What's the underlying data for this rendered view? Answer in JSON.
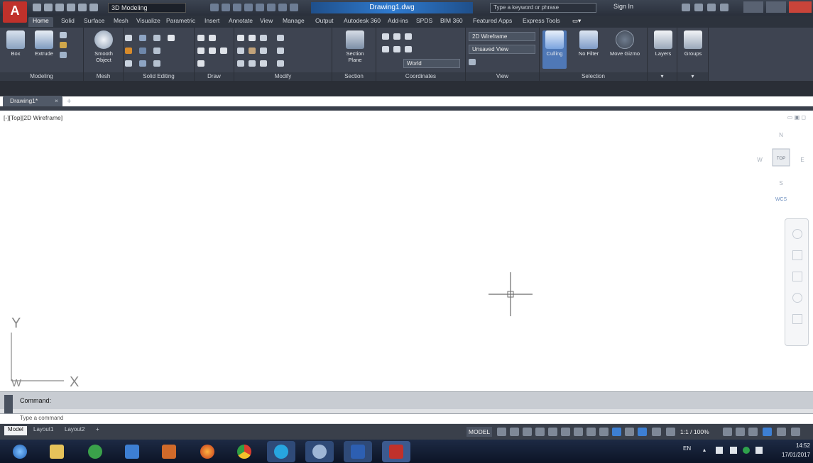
{
  "title_bar": {
    "logo": "A",
    "workspace": "3D Modeling",
    "file_title": "Drawing1.dwg",
    "search_placeholder": "Type a keyword or phrase",
    "sign_in": "Sign In"
  },
  "ribbon": {
    "tabs": [
      "Home",
      "Solid",
      "Surface",
      "Mesh",
      "Visualize",
      "Parametric",
      "Insert",
      "Annotate",
      "View",
      "Manage",
      "Output",
      "Autodesk 360",
      "Add-ins",
      "SPDS",
      "BIM 360",
      "Featured Apps",
      "Express Tools"
    ],
    "active_tab": "Home",
    "panels": {
      "modeling": "Modeling",
      "mesh": "Mesh",
      "solid_editing": "Solid Editing",
      "draw": "Draw",
      "modify": "Modify",
      "section": "Section",
      "coordinates": "Coordinates",
      "view": "View",
      "selection": "Selection"
    },
    "buttons": {
      "box": "Box",
      "extrude": "Extrude",
      "smooth_object": "Smooth Object",
      "section_plane": "Section Plane",
      "culling": "Culling",
      "no_filter": "No Filter",
      "move_gizmo": "Move Gizmo",
      "layers": "Layers",
      "groups": "Groups"
    },
    "visual_style": "2D Wireframe",
    "saved_view": "Unsaved View",
    "ucs": "World"
  },
  "document": {
    "tab": "Drawing1*",
    "view_label": "[-][Top][2D Wireframe]"
  },
  "viewcube": {
    "north": "N",
    "south": "S",
    "east": "E",
    "west": "W",
    "face": "TOP",
    "wcs": "WCS"
  },
  "ucs_icon": {
    "y": "Y",
    "x": "X",
    "w": "W"
  },
  "command": {
    "history": "Command:",
    "placeholder": "Type a command"
  },
  "layout_tabs": [
    "Model",
    "Layout1",
    "Layout2"
  ],
  "status": {
    "space": "MODEL",
    "scale": "1:1 / 100%"
  },
  "tray": {
    "lang": "EN",
    "time": "14:52",
    "date": "17/01/2017"
  },
  "colors": {
    "ribbon_bg": "#3e4451",
    "title_bg": "#2a303b",
    "accent_blue": "#2f7bd0",
    "logo_red": "#c0312b"
  }
}
